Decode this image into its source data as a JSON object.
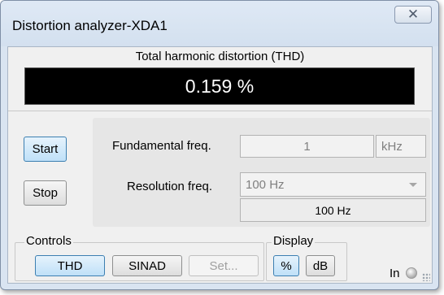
{
  "window": {
    "title": "Distortion analyzer-XDA1",
    "close_glyph": "✕"
  },
  "thd": {
    "label": "Total harmonic distortion (THD)",
    "value": "0.159 %"
  },
  "actions": {
    "start_label": "Start",
    "stop_label": "Stop"
  },
  "frequency": {
    "fundamental_label": "Fundamental freq.",
    "fundamental_value": "1",
    "fundamental_unit": "kHz",
    "resolution_label": "Resolution freq.",
    "resolution_selected": "100 Hz",
    "resolution_readout": "100 Hz"
  },
  "controls": {
    "title": "Controls",
    "thd_label": "THD",
    "sinad_label": "SINAD",
    "set_label": "Set..."
  },
  "display": {
    "title": "Display",
    "percent_label": "%",
    "db_label": "dB"
  },
  "status": {
    "in_label": "In"
  },
  "icons": {
    "close": "close-icon",
    "dropdown": "chevron-down-icon",
    "indicator": "input-led-icon",
    "grip": "resize-grip-icon"
  }
}
